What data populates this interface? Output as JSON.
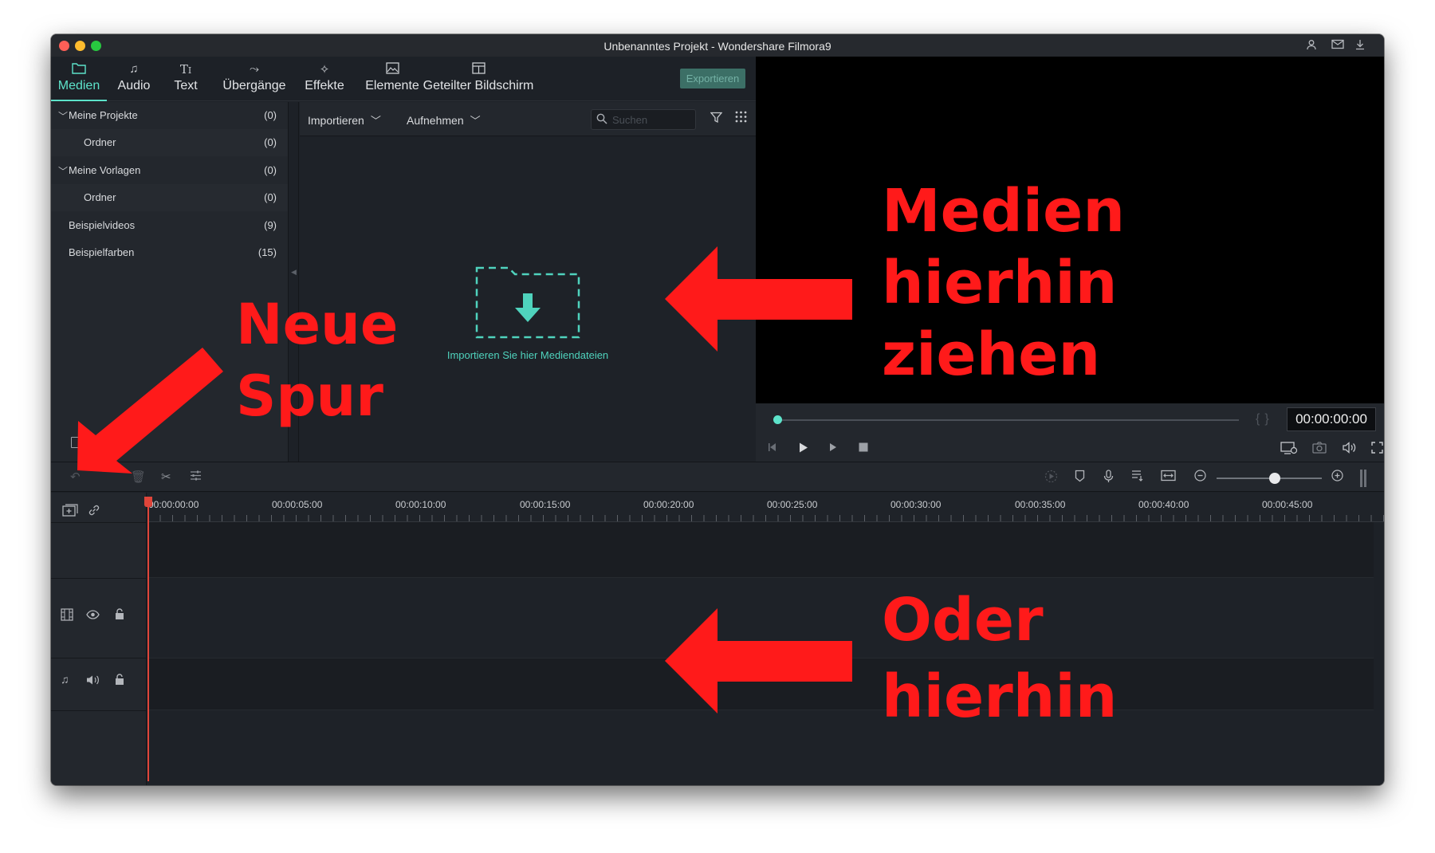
{
  "window": {
    "title": "Unbenanntes Projekt - Wondershare Filmora9"
  },
  "nav": {
    "tabs": [
      {
        "label": "Medien",
        "icon": "folder-icon",
        "active": true
      },
      {
        "label": "Audio",
        "icon": "music-note-icon",
        "active": false
      },
      {
        "label": "Text",
        "icon": "text-icon",
        "active": false
      },
      {
        "label": "Übergänge",
        "icon": "transition-icon",
        "active": false
      },
      {
        "label": "Effekte",
        "icon": "effects-icon",
        "active": false
      },
      {
        "label": "Elemente",
        "icon": "image-icon",
        "active": false
      },
      {
        "label": "Geteilter Bildschirm",
        "icon": "split-screen-icon",
        "active": false
      }
    ],
    "export_label": "Exportieren"
  },
  "library": {
    "items": [
      {
        "label": "Meine Projekte",
        "count": "(0)",
        "expanded": true
      },
      {
        "label": "Ordner",
        "count": "(0)",
        "sub": true
      },
      {
        "label": "Meine Vorlagen",
        "count": "(0)",
        "expanded": true
      },
      {
        "label": "Ordner",
        "count": "(0)",
        "sub": true
      },
      {
        "label": "Beispielvideos",
        "count": "(9)"
      },
      {
        "label": "Beispielfarben",
        "count": "(15)"
      }
    ]
  },
  "media": {
    "import_label": "Importieren",
    "record_label": "Aufnehmen",
    "search_placeholder": "Suchen",
    "drop_text": "Importieren Sie hier Mediendateien"
  },
  "preview": {
    "timecode": "00:00:00:00",
    "progress": 0
  },
  "timeline": {
    "ticks": [
      "00:00:00:00",
      "00:00:05:00",
      "00:00:10:00",
      "00:00:15:00",
      "00:00:20:00",
      "00:00:25:00",
      "00:00:30:00",
      "00:00:35:00",
      "00:00:40:00",
      "00:00:45:00"
    ],
    "zoom": 0.5
  },
  "annotations": {
    "medien": [
      "Medien",
      "hierhin",
      "ziehen"
    ],
    "neue_spur": [
      "Neue",
      "Spur"
    ],
    "oder": [
      "Oder",
      "hierhin"
    ]
  },
  "colors": {
    "accent": "#5de3ca",
    "annotation": "#ff1a1a",
    "playhead": "#e0453a"
  }
}
